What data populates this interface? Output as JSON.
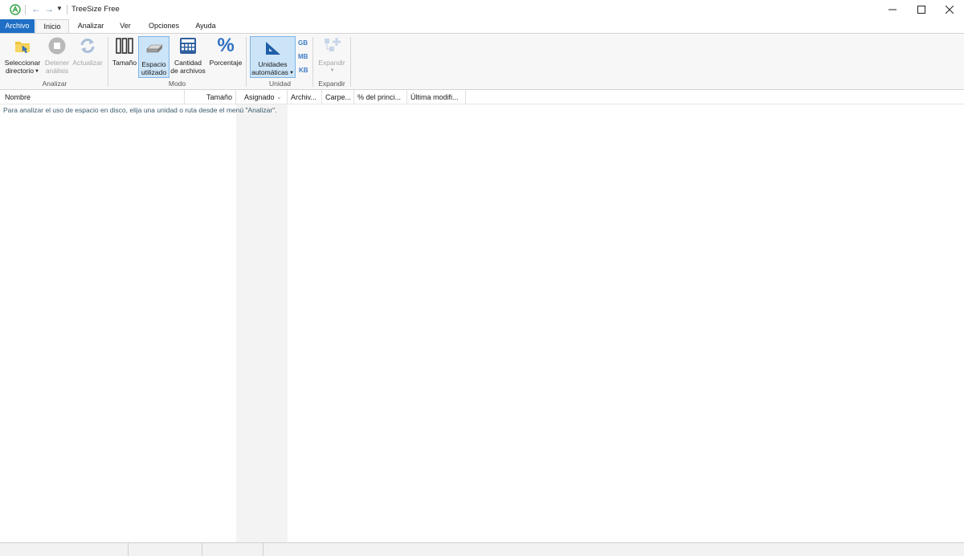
{
  "window": {
    "title": "TreeSize Free"
  },
  "tabs": [
    {
      "label": "Archivo"
    },
    {
      "label": "Inicio"
    },
    {
      "label": "Analizar"
    },
    {
      "label": "Ver"
    },
    {
      "label": "Opciones"
    },
    {
      "label": "Ayuda"
    }
  ],
  "ribbon": {
    "analizar": {
      "group_label": "Analizar",
      "select_dir": {
        "line1": "Seleccionar",
        "line2": "directorio"
      },
      "stop": {
        "line1": "Detener",
        "line2": "análisis"
      },
      "refresh": {
        "line1": "Actualizar"
      }
    },
    "modo": {
      "group_label": "Modo",
      "size": {
        "line1": "Tamaño"
      },
      "used_space": {
        "line1": "Espacio",
        "line2": "utilizado"
      },
      "file_count": {
        "line1": "Cantidad",
        "line2": "de archivos"
      },
      "percent": {
        "line1": "Porcentaje"
      }
    },
    "unidad": {
      "group_label": "Unidad",
      "auto_units": {
        "line1": "Unidades",
        "line2": "automáticas"
      },
      "gb": "GB",
      "mb": "MB",
      "kb": "KB"
    },
    "expandir": {
      "group_label": "Expandir",
      "expand": {
        "line1": "Expandir"
      }
    }
  },
  "columns": [
    {
      "label": "Nombre"
    },
    {
      "label": "Tamaño"
    },
    {
      "label": "Asignado"
    },
    {
      "label": "Archiv..."
    },
    {
      "label": "Carpe..."
    },
    {
      "label": "% del princi..."
    },
    {
      "label": "Última modifi..."
    }
  ],
  "content": {
    "hint": "Para analizar el uso de espacio en disco, elija una unidad o ruta desde el menú \"Analizar\"."
  },
  "colors": {
    "accent": "#1f6fc6",
    "selected_bg": "#cce4f7",
    "icon_blue": "#3e7dc4"
  }
}
